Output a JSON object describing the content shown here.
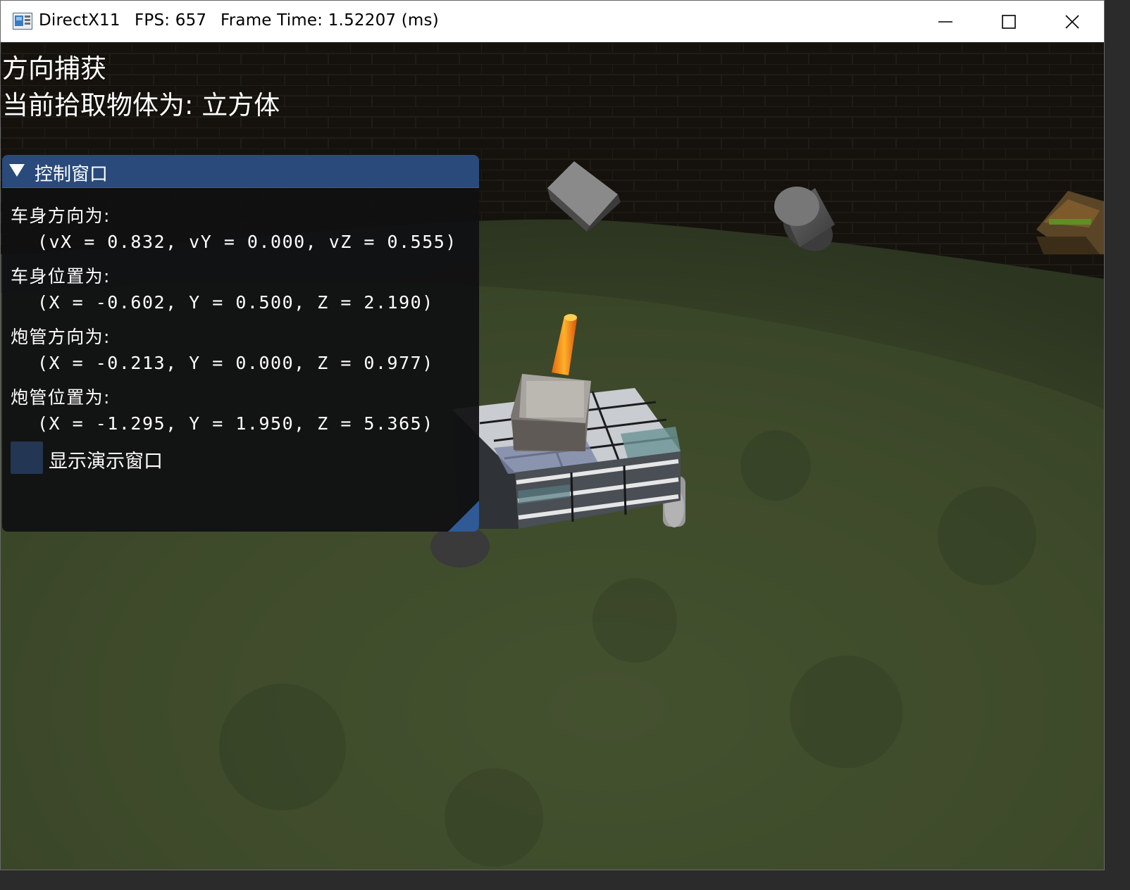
{
  "window": {
    "app_name": "DirectX11",
    "fps_text": "FPS: 657",
    "frame_time_text": "Frame Time: 1.52207 (ms)",
    "controls": {
      "minimize": "minimize",
      "maximize": "maximize",
      "close": "close"
    }
  },
  "overlay": {
    "mode": "方向捕获",
    "picked_object": "当前拾取物体为: 立方体"
  },
  "control_window": {
    "title": "控制窗口",
    "body_direction_label": "车身方向为:",
    "body_direction_value": "(vX = 0.832, vY = 0.000, vZ = 0.555)",
    "body_position_label": "车身位置为:",
    "body_position_value": "(X = -0.602, Y = 0.500, Z = 2.190)",
    "barrel_direction_label": "炮管方向为:",
    "barrel_direction_value": "(X = -0.213, Y = 0.000, Z = 0.977)",
    "barrel_position_label": "炮管位置为:",
    "barrel_position_value": "(X = -1.295, Y = 1.950, Z = 5.365)",
    "show_demo_checked": false,
    "show_demo_label": "显示演示窗口"
  },
  "colors": {
    "imgui_title_bg": "#294a7a",
    "imgui_window_bg": "#101012",
    "checkbox_bg": "#233653",
    "grass": "#3f4c2c",
    "brick_wall": "#1f1b15"
  }
}
